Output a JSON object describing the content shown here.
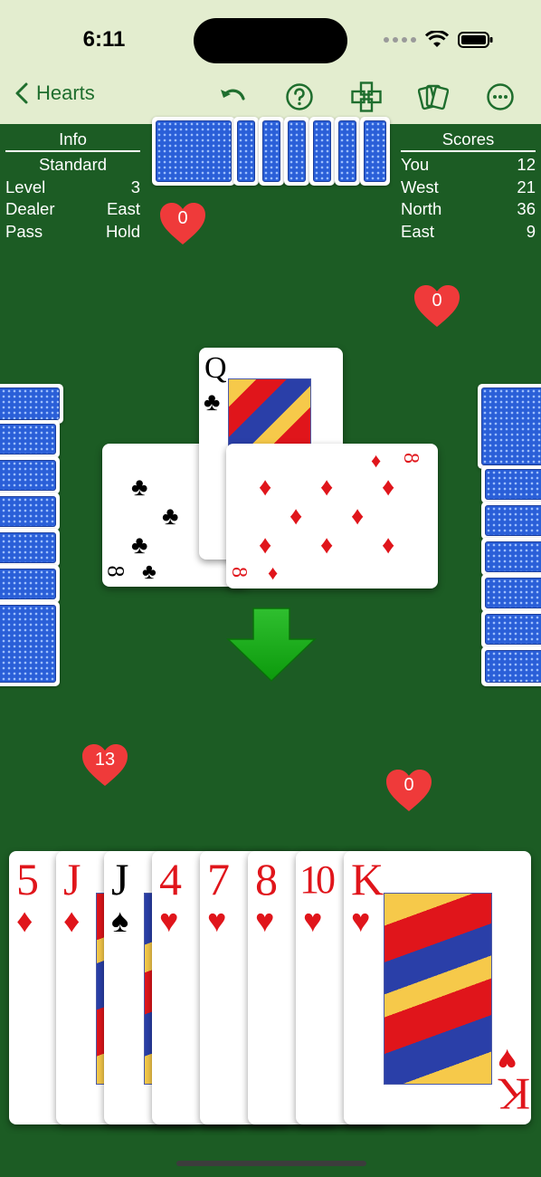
{
  "status": {
    "time": "6:11"
  },
  "nav": {
    "back_label": "Hearts"
  },
  "info": {
    "header": "Info",
    "mode": "Standard",
    "rows": [
      {
        "label": "Level",
        "value": "3"
      },
      {
        "label": "Dealer",
        "value": "East"
      },
      {
        "label": "Pass",
        "value": "Hold"
      }
    ]
  },
  "scores": {
    "header": "Scores",
    "rows": [
      {
        "label": "You",
        "value": "12"
      },
      {
        "label": "West",
        "value": "21"
      },
      {
        "label": "North",
        "value": "36"
      },
      {
        "label": "East",
        "value": "9"
      }
    ]
  },
  "heart_counts": {
    "north": "0",
    "east": "0",
    "west": "13",
    "south": "0"
  },
  "trick": {
    "north_card": {
      "rank": "Q",
      "suit": "♣"
    },
    "west_card": {
      "rank": "8",
      "suit": "♣"
    },
    "east_card": {
      "rank": "8",
      "suit": "♦"
    }
  },
  "hand": [
    {
      "rank": "5",
      "suit": "♦"
    },
    {
      "rank": "J",
      "suit": "♦"
    },
    {
      "rank": "J",
      "suit": "♠"
    },
    {
      "rank": "4",
      "suit": "♥"
    },
    {
      "rank": "7",
      "suit": "♥"
    },
    {
      "rank": "8",
      "suit": "♥"
    },
    {
      "rank": "10",
      "suit": "♥"
    },
    {
      "rank": "K",
      "suit": "♥"
    }
  ],
  "colors": {
    "felt": "#1c5c24",
    "toolbar": "#e3edcf",
    "accent": "#1f6e2e",
    "card_red": "#e0151b",
    "card_back": "#2a5fd8"
  }
}
